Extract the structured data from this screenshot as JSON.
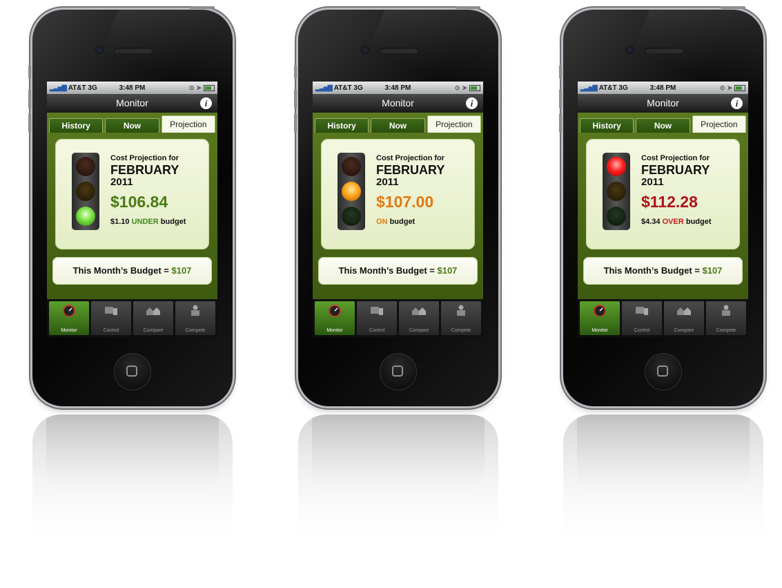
{
  "phones": [
    {
      "status": {
        "carrier": "AT&T 3G",
        "time": "3:48 PM"
      },
      "nav": {
        "title": "Monitor",
        "info": "i"
      },
      "tabs": [
        "History",
        "Now",
        "Projection"
      ],
      "active_tab": "Projection",
      "projection": {
        "label": "Cost Projection for",
        "month": "FEBRUARY",
        "year": "2011",
        "amount": "$106.84",
        "amount_color": "#4a7a16",
        "diff": "$1.10",
        "status_word": "UNDER",
        "status_color": "#3f8a1a",
        "status_suffix": "budget",
        "light": "green"
      },
      "budget": {
        "label": "This Month’s Budget =",
        "value": "$107"
      },
      "tabbar": [
        "Monitor",
        "Control",
        "Compare",
        "Compete"
      ],
      "active_tabbar": "Monitor"
    },
    {
      "status": {
        "carrier": "AT&T 3G",
        "time": "3:48 PM"
      },
      "nav": {
        "title": "Monitor",
        "info": "i"
      },
      "tabs": [
        "History",
        "Now",
        "Projection"
      ],
      "active_tab": "Projection",
      "projection": {
        "label": "Cost Projection for",
        "month": "FEBRUARY",
        "year": "2011",
        "amount": "$107.00",
        "amount_color": "#e07a12",
        "diff": "",
        "status_word": "ON",
        "status_color": "#e07a12",
        "status_suffix": "budget",
        "light": "yellow"
      },
      "budget": {
        "label": "This Month’s Budget =",
        "value": "$107"
      },
      "tabbar": [
        "Monitor",
        "Control",
        "Compare",
        "Compete"
      ],
      "active_tabbar": "Monitor"
    },
    {
      "status": {
        "carrier": "AT&T 3G",
        "time": "3:48 PM"
      },
      "nav": {
        "title": "Monitor",
        "info": "i"
      },
      "tabs": [
        "History",
        "Now",
        "Projection"
      ],
      "active_tab": "Projection",
      "projection": {
        "label": "Cost Projection for",
        "month": "FEBRUARY",
        "year": "2011",
        "amount": "$112.28",
        "amount_color": "#b0121a",
        "diff": "$4.34",
        "status_word": "OVER",
        "status_color": "#c41a1a",
        "status_suffix": "budget",
        "light": "red"
      },
      "budget": {
        "label": "This Month’s Budget =",
        "value": "$107"
      },
      "tabbar": [
        "Monitor",
        "Control",
        "Compare",
        "Compete"
      ],
      "active_tabbar": "Monitor"
    }
  ],
  "icons": [
    "signal-icon",
    "location-icon",
    "battery-icon",
    "info-icon",
    "monitor-gauge-icon",
    "control-icon",
    "compare-icon",
    "compete-icon",
    "home-button-icon"
  ]
}
